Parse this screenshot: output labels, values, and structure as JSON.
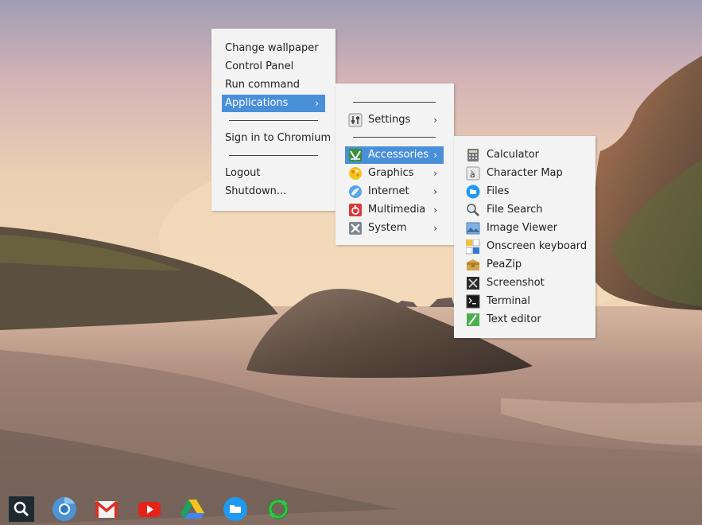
{
  "desktop_menu": {
    "items": [
      {
        "label": "Change wallpaper"
      },
      {
        "label": "Control Panel"
      },
      {
        "label": "Run command"
      },
      {
        "label": "Applications",
        "chevron": "›"
      },
      {
        "label": "Sign in to Chromium"
      },
      {
        "label": "Logout"
      },
      {
        "label": "Shutdown..."
      }
    ]
  },
  "applications_menu": {
    "items": [
      {
        "label": "Settings",
        "icon": "settings-icon",
        "chevron": "›"
      },
      {
        "label": "Accessories",
        "icon": "accessories-icon",
        "chevron": "›"
      },
      {
        "label": "Graphics",
        "icon": "graphics-icon",
        "chevron": "›"
      },
      {
        "label": "Internet",
        "icon": "internet-icon",
        "chevron": "›"
      },
      {
        "label": "Multimedia",
        "icon": "multimedia-icon",
        "chevron": "›"
      },
      {
        "label": "System",
        "icon": "system-icon",
        "chevron": "›"
      }
    ]
  },
  "accessories_menu": {
    "items": [
      {
        "label": "Calculator",
        "icon": "calculator-icon"
      },
      {
        "label": "Character Map",
        "icon": "character-map-icon"
      },
      {
        "label": "Files",
        "icon": "files-icon"
      },
      {
        "label": "File Search",
        "icon": "file-search-icon"
      },
      {
        "label": "Image Viewer",
        "icon": "image-viewer-icon"
      },
      {
        "label": "Onscreen keyboard",
        "icon": "onscreen-keyboard-icon"
      },
      {
        "label": "PeaZip",
        "icon": "peazip-icon"
      },
      {
        "label": "Screenshot",
        "icon": "screenshot-icon"
      },
      {
        "label": "Terminal",
        "icon": "terminal-icon"
      },
      {
        "label": "Text editor",
        "icon": "text-editor-icon"
      }
    ]
  },
  "shelf": {
    "items": [
      {
        "name": "launcher-search-icon"
      },
      {
        "name": "chromium-icon"
      },
      {
        "name": "gmail-icon"
      },
      {
        "name": "youtube-icon"
      },
      {
        "name": "drive-icon"
      },
      {
        "name": "files-icon"
      },
      {
        "name": "sync-icon"
      }
    ]
  },
  "colors": {
    "selection": "#4a90d9",
    "menu_background": "#f3f3f3",
    "menu_text": "#222222"
  }
}
